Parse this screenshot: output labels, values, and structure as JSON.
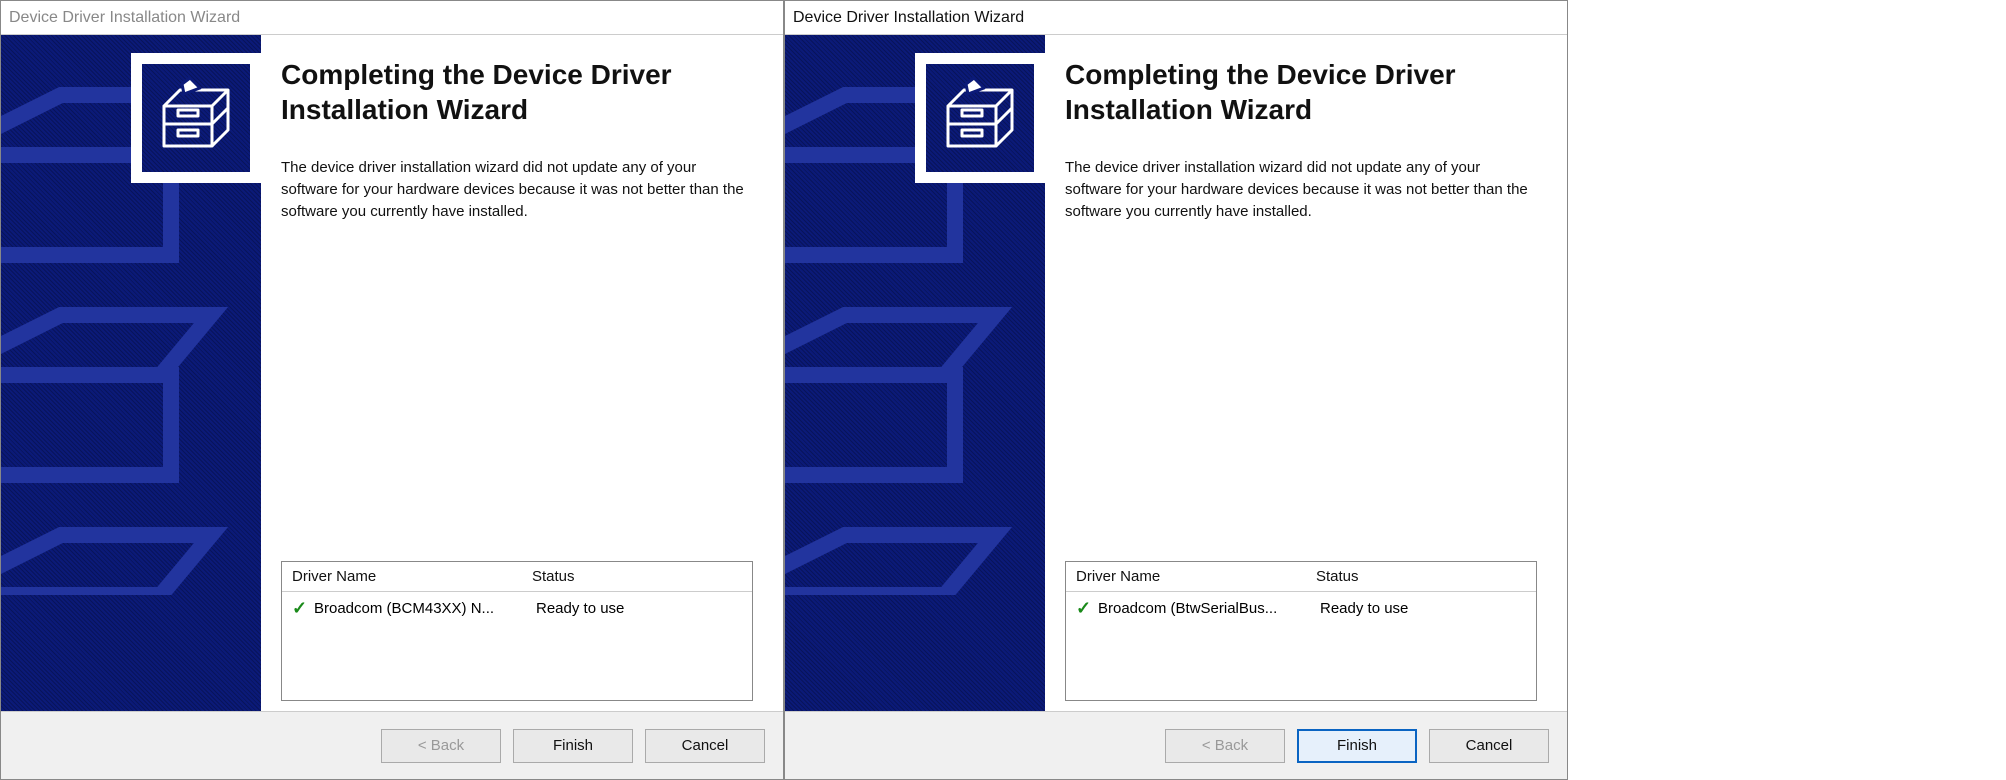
{
  "windows": [
    {
      "active": false,
      "title": "Device Driver Installation Wizard",
      "heading": "Completing the Device Driver Installation Wizard",
      "body": "The device driver installation wizard did not update any of your software for your hardware devices because it was not better than the software you currently have installed.",
      "table": {
        "headers": {
          "name": "Driver Name",
          "status": "Status"
        },
        "rows": [
          {
            "icon": "check",
            "name": "Broadcom (BCM43XX) N...",
            "status": "Ready to use"
          }
        ]
      },
      "buttons": {
        "back": "< Back",
        "finish": "Finish",
        "cancel": "Cancel"
      },
      "default_button": null
    },
    {
      "active": true,
      "title": "Device Driver Installation Wizard",
      "heading": "Completing the Device Driver Installation Wizard",
      "body": "The device driver installation wizard did not update any of your software for your hardware devices because it was not better than the software you currently have installed.",
      "table": {
        "headers": {
          "name": "Driver Name",
          "status": "Status"
        },
        "rows": [
          {
            "icon": "check",
            "name": "Broadcom (BtwSerialBus...",
            "status": "Ready to use"
          }
        ]
      },
      "buttons": {
        "back": "< Back",
        "finish": "Finish",
        "cancel": "Cancel"
      },
      "default_button": "finish"
    }
  ]
}
